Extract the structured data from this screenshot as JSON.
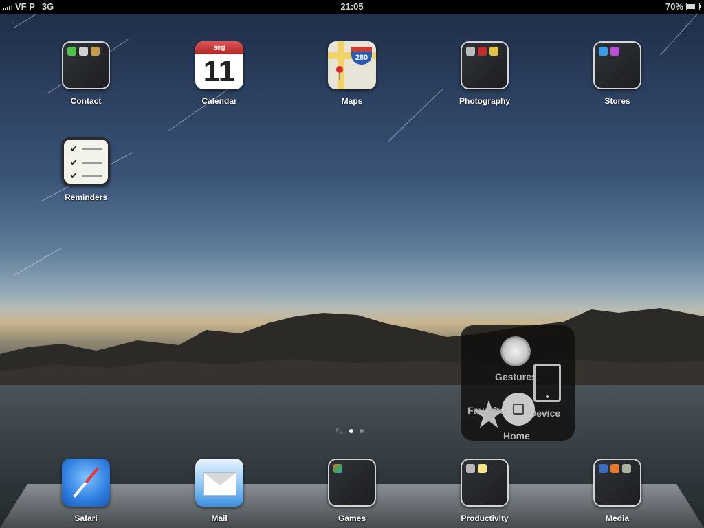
{
  "status_bar": {
    "carrier": "VF P",
    "network": "3G",
    "time": "21:05",
    "battery_percent_text": "70%",
    "battery_level": 0.7
  },
  "home_apps": [
    {
      "label": "Contact",
      "kind": "folder"
    },
    {
      "label": "Calendar",
      "kind": "calendar",
      "weekday": "seg",
      "day": "11"
    },
    {
      "label": "Maps",
      "kind": "maps",
      "shield_number": "280"
    },
    {
      "label": "Photography",
      "kind": "folder"
    },
    {
      "label": "Stores",
      "kind": "folder"
    },
    {
      "label": "Reminders",
      "kind": "reminders"
    }
  ],
  "dock_apps": [
    {
      "label": "Safari"
    },
    {
      "label": "Mail"
    },
    {
      "label": "Games"
    },
    {
      "label": "Productivity"
    },
    {
      "label": "Media"
    }
  ],
  "page_indicator": {
    "pages": 2,
    "current": 1
  },
  "assistive_touch": {
    "gestures": "Gestures",
    "favorites": "Favorites",
    "device": "Device",
    "home": "Home"
  },
  "colors": {
    "folder_border": "#d5d5d5",
    "calendar_header": "#c83232",
    "label_text": "#ffffff"
  }
}
